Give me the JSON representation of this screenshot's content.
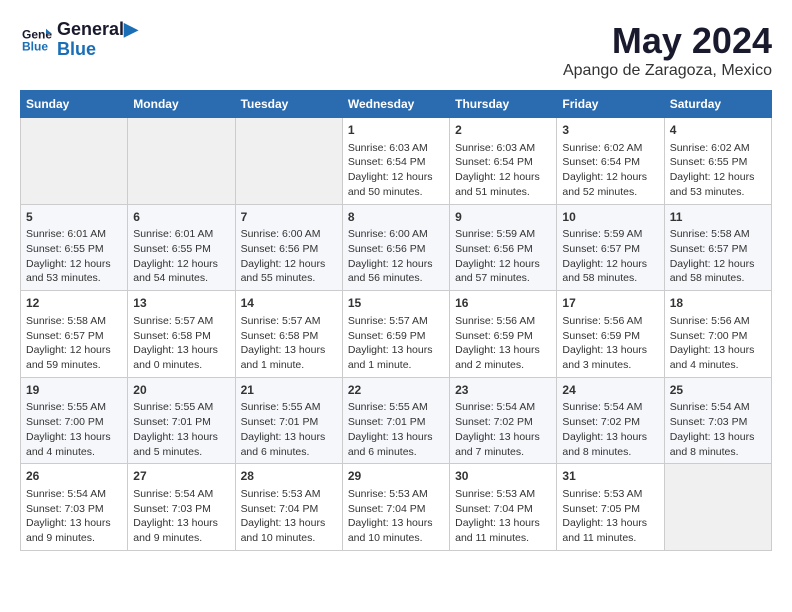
{
  "header": {
    "logo_line1": "General",
    "logo_line2": "Blue",
    "title": "May 2024",
    "subtitle": "Apango de Zaragoza, Mexico"
  },
  "days_of_week": [
    "Sunday",
    "Monday",
    "Tuesday",
    "Wednesday",
    "Thursday",
    "Friday",
    "Saturday"
  ],
  "weeks": [
    [
      {
        "day": "",
        "info": ""
      },
      {
        "day": "",
        "info": ""
      },
      {
        "day": "",
        "info": ""
      },
      {
        "day": "1",
        "info": "Sunrise: 6:03 AM\nSunset: 6:54 PM\nDaylight: 12 hours\nand 50 minutes."
      },
      {
        "day": "2",
        "info": "Sunrise: 6:03 AM\nSunset: 6:54 PM\nDaylight: 12 hours\nand 51 minutes."
      },
      {
        "day": "3",
        "info": "Sunrise: 6:02 AM\nSunset: 6:54 PM\nDaylight: 12 hours\nand 52 minutes."
      },
      {
        "day": "4",
        "info": "Sunrise: 6:02 AM\nSunset: 6:55 PM\nDaylight: 12 hours\nand 53 minutes."
      }
    ],
    [
      {
        "day": "5",
        "info": "Sunrise: 6:01 AM\nSunset: 6:55 PM\nDaylight: 12 hours\nand 53 minutes."
      },
      {
        "day": "6",
        "info": "Sunrise: 6:01 AM\nSunset: 6:55 PM\nDaylight: 12 hours\nand 54 minutes."
      },
      {
        "day": "7",
        "info": "Sunrise: 6:00 AM\nSunset: 6:56 PM\nDaylight: 12 hours\nand 55 minutes."
      },
      {
        "day": "8",
        "info": "Sunrise: 6:00 AM\nSunset: 6:56 PM\nDaylight: 12 hours\nand 56 minutes."
      },
      {
        "day": "9",
        "info": "Sunrise: 5:59 AM\nSunset: 6:56 PM\nDaylight: 12 hours\nand 57 minutes."
      },
      {
        "day": "10",
        "info": "Sunrise: 5:59 AM\nSunset: 6:57 PM\nDaylight: 12 hours\nand 58 minutes."
      },
      {
        "day": "11",
        "info": "Sunrise: 5:58 AM\nSunset: 6:57 PM\nDaylight: 12 hours\nand 58 minutes."
      }
    ],
    [
      {
        "day": "12",
        "info": "Sunrise: 5:58 AM\nSunset: 6:57 PM\nDaylight: 12 hours\nand 59 minutes."
      },
      {
        "day": "13",
        "info": "Sunrise: 5:57 AM\nSunset: 6:58 PM\nDaylight: 13 hours\nand 0 minutes."
      },
      {
        "day": "14",
        "info": "Sunrise: 5:57 AM\nSunset: 6:58 PM\nDaylight: 13 hours\nand 1 minute."
      },
      {
        "day": "15",
        "info": "Sunrise: 5:57 AM\nSunset: 6:59 PM\nDaylight: 13 hours\nand 1 minute."
      },
      {
        "day": "16",
        "info": "Sunrise: 5:56 AM\nSunset: 6:59 PM\nDaylight: 13 hours\nand 2 minutes."
      },
      {
        "day": "17",
        "info": "Sunrise: 5:56 AM\nSunset: 6:59 PM\nDaylight: 13 hours\nand 3 minutes."
      },
      {
        "day": "18",
        "info": "Sunrise: 5:56 AM\nSunset: 7:00 PM\nDaylight: 13 hours\nand 4 minutes."
      }
    ],
    [
      {
        "day": "19",
        "info": "Sunrise: 5:55 AM\nSunset: 7:00 PM\nDaylight: 13 hours\nand 4 minutes."
      },
      {
        "day": "20",
        "info": "Sunrise: 5:55 AM\nSunset: 7:01 PM\nDaylight: 13 hours\nand 5 minutes."
      },
      {
        "day": "21",
        "info": "Sunrise: 5:55 AM\nSunset: 7:01 PM\nDaylight: 13 hours\nand 6 minutes."
      },
      {
        "day": "22",
        "info": "Sunrise: 5:55 AM\nSunset: 7:01 PM\nDaylight: 13 hours\nand 6 minutes."
      },
      {
        "day": "23",
        "info": "Sunrise: 5:54 AM\nSunset: 7:02 PM\nDaylight: 13 hours\nand 7 minutes."
      },
      {
        "day": "24",
        "info": "Sunrise: 5:54 AM\nSunset: 7:02 PM\nDaylight: 13 hours\nand 8 minutes."
      },
      {
        "day": "25",
        "info": "Sunrise: 5:54 AM\nSunset: 7:03 PM\nDaylight: 13 hours\nand 8 minutes."
      }
    ],
    [
      {
        "day": "26",
        "info": "Sunrise: 5:54 AM\nSunset: 7:03 PM\nDaylight: 13 hours\nand 9 minutes."
      },
      {
        "day": "27",
        "info": "Sunrise: 5:54 AM\nSunset: 7:03 PM\nDaylight: 13 hours\nand 9 minutes."
      },
      {
        "day": "28",
        "info": "Sunrise: 5:53 AM\nSunset: 7:04 PM\nDaylight: 13 hours\nand 10 minutes."
      },
      {
        "day": "29",
        "info": "Sunrise: 5:53 AM\nSunset: 7:04 PM\nDaylight: 13 hours\nand 10 minutes."
      },
      {
        "day": "30",
        "info": "Sunrise: 5:53 AM\nSunset: 7:04 PM\nDaylight: 13 hours\nand 11 minutes."
      },
      {
        "day": "31",
        "info": "Sunrise: 5:53 AM\nSunset: 7:05 PM\nDaylight: 13 hours\nand 11 minutes."
      },
      {
        "day": "",
        "info": ""
      }
    ]
  ]
}
